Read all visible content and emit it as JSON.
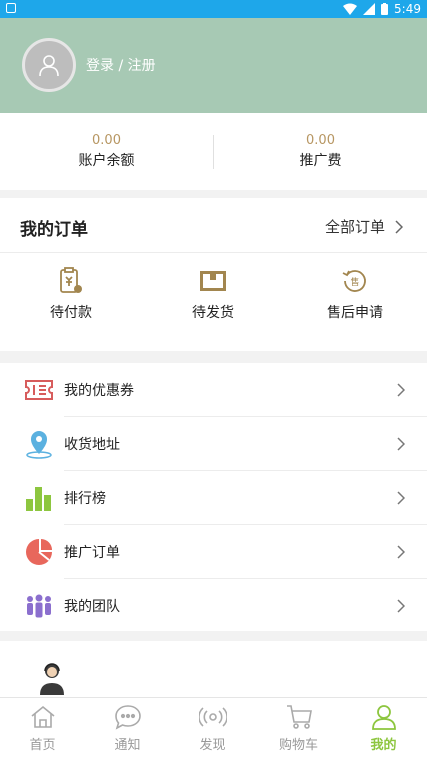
{
  "status_bar": {
    "time": "5:49"
  },
  "profile": {
    "login_label": "登录 / 注册"
  },
  "balance": [
    {
      "value": "0.00",
      "label": "账户余额"
    },
    {
      "value": "0.00",
      "label": "推广费"
    }
  ],
  "orders": {
    "title": "我的订单",
    "all_label": "全部订单",
    "items": [
      {
        "label": "待付款",
        "icon": "clipboard-yen-icon"
      },
      {
        "label": "待发货",
        "icon": "package-box-icon"
      },
      {
        "label": "售后申请",
        "icon": "after-sales-icon"
      }
    ]
  },
  "menu": [
    {
      "label": "我的优惠券",
      "icon": "coupon-icon"
    },
    {
      "label": "收货地址",
      "icon": "location-pin-icon"
    },
    {
      "label": "排行榜",
      "icon": "bar-chart-icon"
    },
    {
      "label": "推广订单",
      "icon": "pie-chart-icon"
    },
    {
      "label": "我的团队",
      "icon": "team-icon"
    }
  ],
  "tabs": [
    {
      "label": "首页",
      "icon": "home-icon"
    },
    {
      "label": "通知",
      "icon": "chat-bubble-icon"
    },
    {
      "label": "发现",
      "icon": "broadcast-icon"
    },
    {
      "label": "购物车",
      "icon": "cart-icon"
    },
    {
      "label": "我的",
      "icon": "user-icon",
      "active": true
    }
  ],
  "colors": {
    "status_bar": "#1ea7ea",
    "header_bg": "#a7c9b4",
    "accent_gold": "#b79662",
    "active_tab": "#8dc63f"
  }
}
